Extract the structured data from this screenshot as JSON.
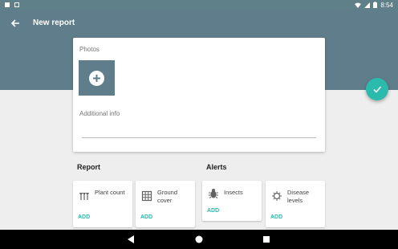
{
  "status_bar": {
    "time": "8:54"
  },
  "app_bar": {
    "title": "New report"
  },
  "form": {
    "photos_label": "Photos",
    "additional_info_label": "Additional info"
  },
  "report_section": {
    "title": "Report",
    "tiles": [
      {
        "label": "Plant count",
        "action": "ADD",
        "icon": "plant-count-icon"
      },
      {
        "label": "Ground cover",
        "action": "ADD",
        "icon": "grid-icon"
      }
    ]
  },
  "alerts_section": {
    "title": "Alerts",
    "tiles": [
      {
        "label": "Insects",
        "action": "ADD",
        "icon": "bug-icon"
      },
      {
        "label": "Disease levels",
        "action": "ADD",
        "icon": "virus-icon"
      }
    ]
  },
  "colors": {
    "app_bar": "#607d8b",
    "accent": "#2bbbad",
    "background": "#eeeeee"
  }
}
